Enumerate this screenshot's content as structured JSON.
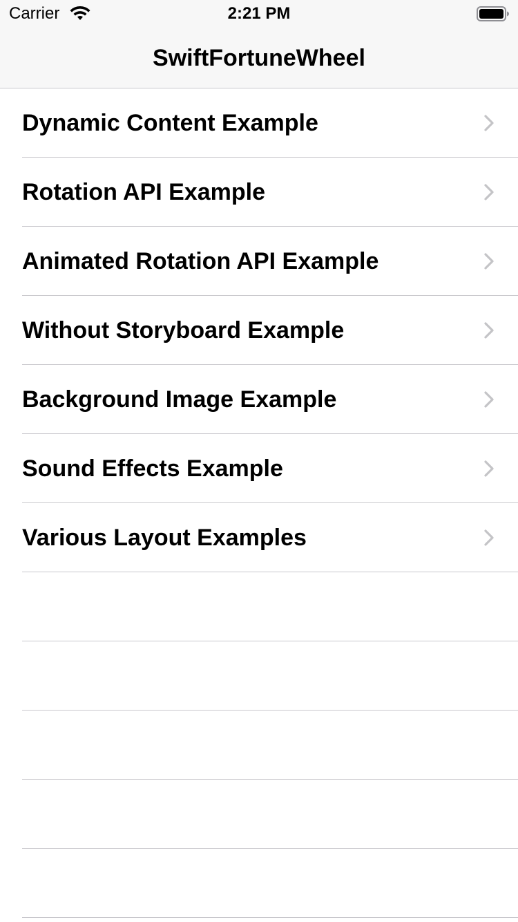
{
  "status_bar": {
    "carrier": "Carrier",
    "time": "2:21 PM",
    "wifi_icon": "wifi-icon",
    "battery_icon": "battery-icon"
  },
  "nav": {
    "title": "SwiftFortuneWheel"
  },
  "list": {
    "items": [
      {
        "label": "Dynamic Content Example",
        "icon": "chevron-right-icon"
      },
      {
        "label": "Rotation API Example",
        "icon": "chevron-right-icon"
      },
      {
        "label": "Animated Rotation API Example",
        "icon": "chevron-right-icon"
      },
      {
        "label": "Without Storyboard Example",
        "icon": "chevron-right-icon"
      },
      {
        "label": "Background Image Example",
        "icon": "chevron-right-icon"
      },
      {
        "label": "Sound Effects Example",
        "icon": "chevron-right-icon"
      },
      {
        "label": "Various Layout Examples",
        "icon": "chevron-right-icon"
      }
    ]
  },
  "colors": {
    "nav_background": "#f7f7f7",
    "separator": "#c8c7cc",
    "chevron": "#c4c4c7",
    "text": "#000000"
  }
}
